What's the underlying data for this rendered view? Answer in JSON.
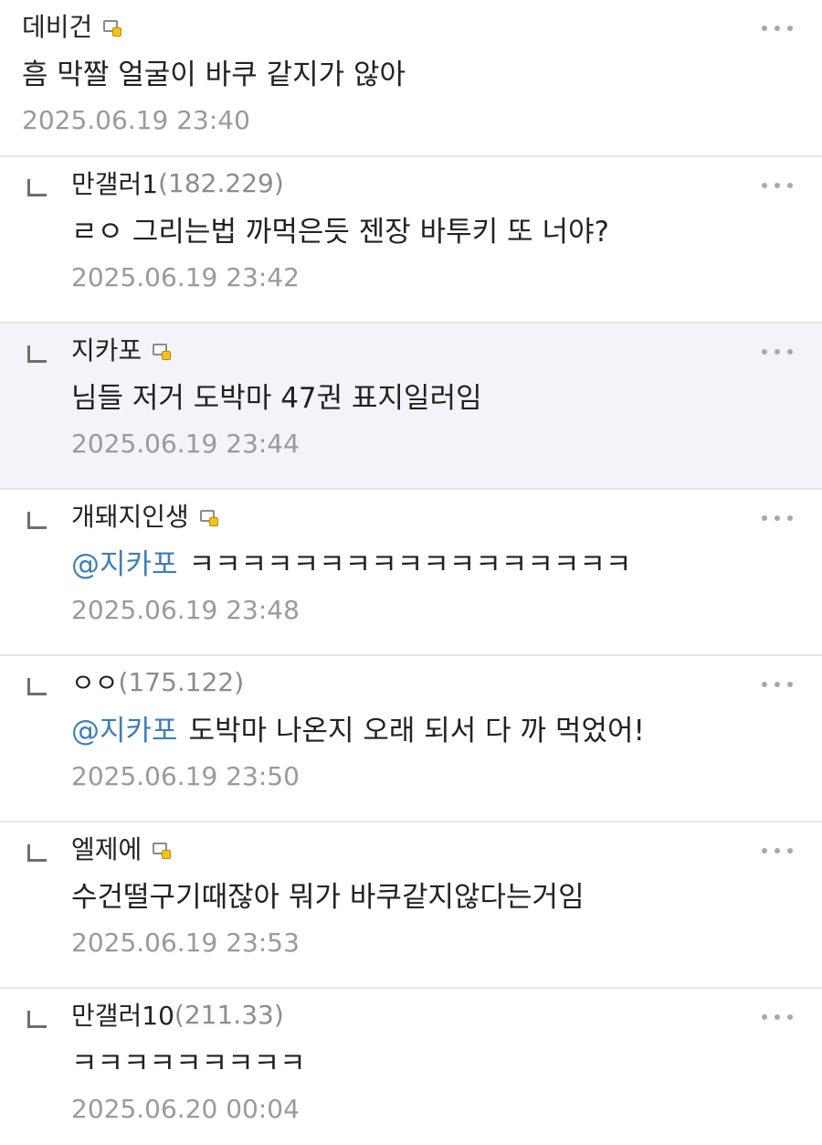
{
  "comments": [
    {
      "nickname": "데비건",
      "ip": "",
      "badge_icon": "member-badge-icon",
      "mention": "",
      "text": "흠 막짤 얼굴이 바쿠 같지가 않아",
      "date": "2025.06.19 23:40",
      "is_reply": false,
      "highlighted": false
    },
    {
      "nickname": "만갤러1",
      "ip": "(182.229)",
      "badge_icon": "",
      "mention": "",
      "text": "ㄹㅇ 그리는법 까먹은듯 젠장 바투키 또 너야?",
      "date": "2025.06.19 23:42",
      "is_reply": true,
      "highlighted": false
    },
    {
      "nickname": "지카포",
      "ip": "",
      "badge_icon": "member-badge-icon",
      "mention": "",
      "text": "님들 저거 도박마 47권 표지일러임",
      "date": "2025.06.19 23:44",
      "is_reply": true,
      "highlighted": true
    },
    {
      "nickname": "개돼지인생",
      "ip": "",
      "badge_icon": "member-badge-icon",
      "mention": "@지카포",
      "text": "ㅋㅋㅋㅋㅋㅋㅋㅋㅋㅋㅋㅋㅋㅋㅋㅋㅋ",
      "date": "2025.06.19 23:48",
      "is_reply": true,
      "highlighted": false
    },
    {
      "nickname": "ㅇㅇ",
      "ip": "(175.122)",
      "badge_icon": "",
      "mention": "@지카포",
      "text": "도박마 나온지 오래 되서 다 까 먹었어!",
      "date": "2025.06.19 23:50",
      "is_reply": true,
      "highlighted": false
    },
    {
      "nickname": "엘제에",
      "ip": "",
      "badge_icon": "member-badge-icon",
      "mention": "",
      "text": "수건떨구기때잖아 뭐가 바쿠같지않다는거임",
      "date": "2025.06.19 23:53",
      "is_reply": true,
      "highlighted": false
    },
    {
      "nickname": "만갤러10",
      "ip": "(211.33)",
      "badge_icon": "",
      "mention": "",
      "text": "ㅋㅋㅋㅋㅋㅋㅋㅋㅋ",
      "date": "2025.06.20 00:04",
      "is_reply": true,
      "highlighted": false
    }
  ],
  "more_icon": "more-options-icon",
  "reply_icon": "reply-arrow-icon",
  "colors": {
    "mention": "#3e7eb8",
    "highlight_bg": "#f3f4fa",
    "ip_text": "#8c8c8c",
    "date_text": "#9a9a9a",
    "divider": "#e6e6ea"
  }
}
